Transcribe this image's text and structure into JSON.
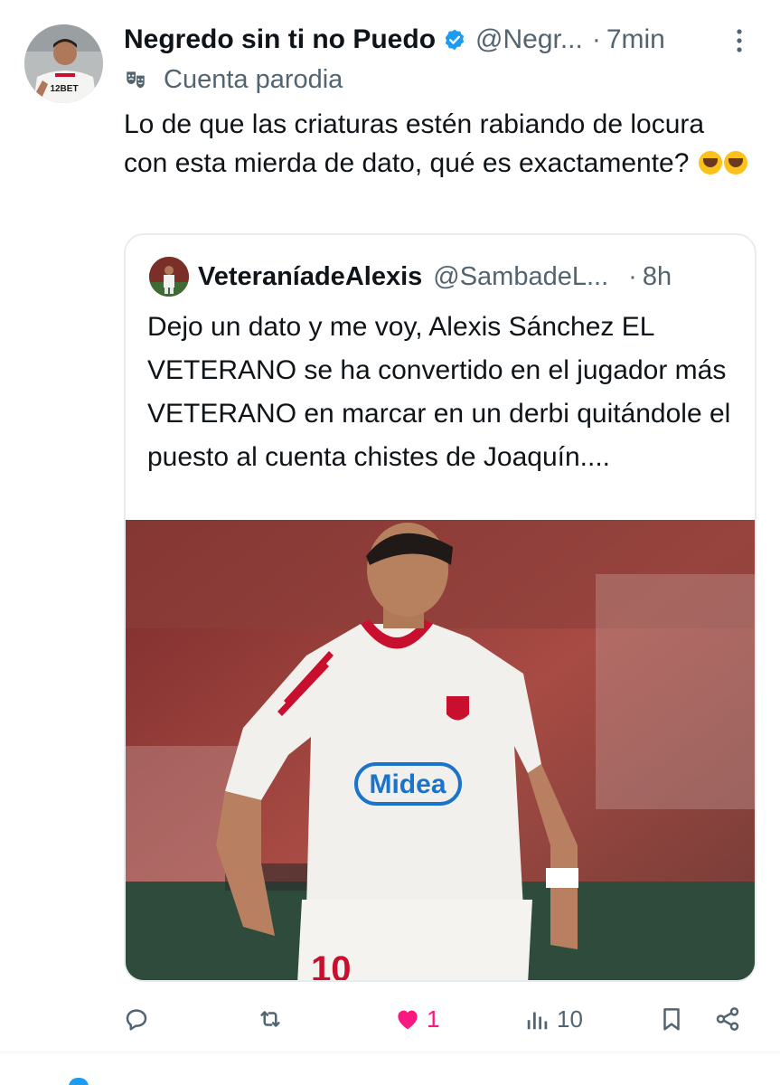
{
  "tweet": {
    "display_name": "Negredo sin ti no Puedo",
    "handle": "@Negr...",
    "separator": "·",
    "time": "7min",
    "label_icon": "parody-mask-icon",
    "label": "Cuenta parodia",
    "text": "Lo de que las criaturas estén rabiando de locura con esta mierda de dato, qué es exactamente?",
    "avatar_jersey_text": "12BET"
  },
  "quote": {
    "display_name": "VeteraníadeAlexis",
    "handle": "@SambadeL...",
    "separator": "·",
    "time": "8h",
    "text": "Dejo un dato y me voy, Alexis Sánchez EL VETERANO se ha convertido en el jugador más VETERANO en marcar en un derbi quitándole el puesto al cuenta chistes de Joaquín....",
    "media_jersey_text": "Midea",
    "media_number": "10"
  },
  "actions": {
    "reply_count": "",
    "retweet_count": "",
    "like_count": "1",
    "views_count": "10"
  },
  "colors": {
    "text": "#0f1419",
    "secondary": "#536471",
    "verified": "#1d9bf0",
    "like": "#f91880",
    "border": "#e6ecf0"
  }
}
